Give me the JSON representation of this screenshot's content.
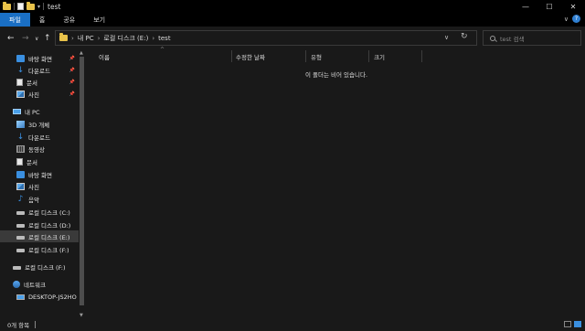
{
  "window": {
    "title": "test",
    "controls": {
      "minimize": "—",
      "maximize": "☐",
      "close": "✕"
    }
  },
  "ribbon": {
    "tabs": [
      "파일",
      "홈",
      "공유",
      "보기"
    ],
    "expand_icon": "∨",
    "help_icon": "?"
  },
  "nav": {
    "back": "←",
    "forward": "→",
    "recent": "∨",
    "up": "↑",
    "breadcrumb": [
      "내 PC",
      "로컬 디스크 (E:)",
      "test"
    ],
    "breadcrumb_sep": "›",
    "dropdown": "∨",
    "refresh": "↻",
    "search_placeholder": "test 검색"
  },
  "sidebar": {
    "quick_access": [
      {
        "label": "바탕 화면",
        "icon": "desktop-icon",
        "pinned": true
      },
      {
        "label": "다운로드",
        "icon": "download-icon",
        "pinned": true
      },
      {
        "label": "문서",
        "icon": "document-icon",
        "pinned": true
      },
      {
        "label": "사진",
        "icon": "pictures-icon",
        "pinned": true
      }
    ],
    "this_pc": {
      "label": "내 PC",
      "children": [
        {
          "label": "3D 개체",
          "icon": "3d-objects-icon"
        },
        {
          "label": "다운로드",
          "icon": "download-icon"
        },
        {
          "label": "동영상",
          "icon": "video-icon"
        },
        {
          "label": "문서",
          "icon": "document-icon"
        },
        {
          "label": "바탕 화면",
          "icon": "desktop-icon"
        },
        {
          "label": "사진",
          "icon": "pictures-icon"
        },
        {
          "label": "음악",
          "icon": "music-icon"
        },
        {
          "label": "로컬 디스크 (C:)",
          "icon": "drive-icon"
        },
        {
          "label": "로컬 디스크 (D:)",
          "icon": "drive-icon"
        },
        {
          "label": "로컬 디스크 (E:)",
          "icon": "drive-icon",
          "selected": true
        },
        {
          "label": "로컬 디스크 (F:)",
          "icon": "drive-icon"
        }
      ]
    },
    "drive_f": {
      "label": "로컬 디스크 (F:)",
      "icon": "drive-icon"
    },
    "network": {
      "label": "네트워크",
      "children": [
        {
          "label": "DESKTOP-JS2HO",
          "icon": "computer-icon"
        }
      ]
    },
    "pin_glyph": "📌"
  },
  "content": {
    "columns": [
      "이름",
      "수정한 날짜",
      "유형",
      "크기"
    ],
    "sort_caret": "^",
    "empty_message": "이 폴더는 비어 있습니다."
  },
  "status": {
    "item_count": "0개 항목"
  },
  "colors": {
    "background": "#191919",
    "titlebar": "#000000",
    "accent": "#1a6fc4",
    "selected": "#3a3a3a"
  }
}
